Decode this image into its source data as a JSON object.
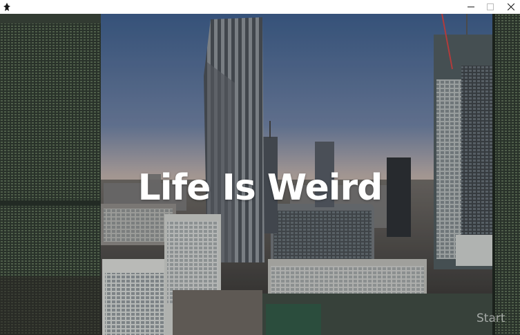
{
  "window": {
    "controls": {
      "minimize_icon": "minimize-icon",
      "maximize_icon": "maximize-icon",
      "close_icon": "close-icon"
    }
  },
  "main": {
    "title": "Life Is Weird",
    "start_label": "Start"
  },
  "colors": {
    "sky_top": "#3e5f8c",
    "sky_bottom": "#c9b6a8",
    "title_text": "#ffffff"
  }
}
